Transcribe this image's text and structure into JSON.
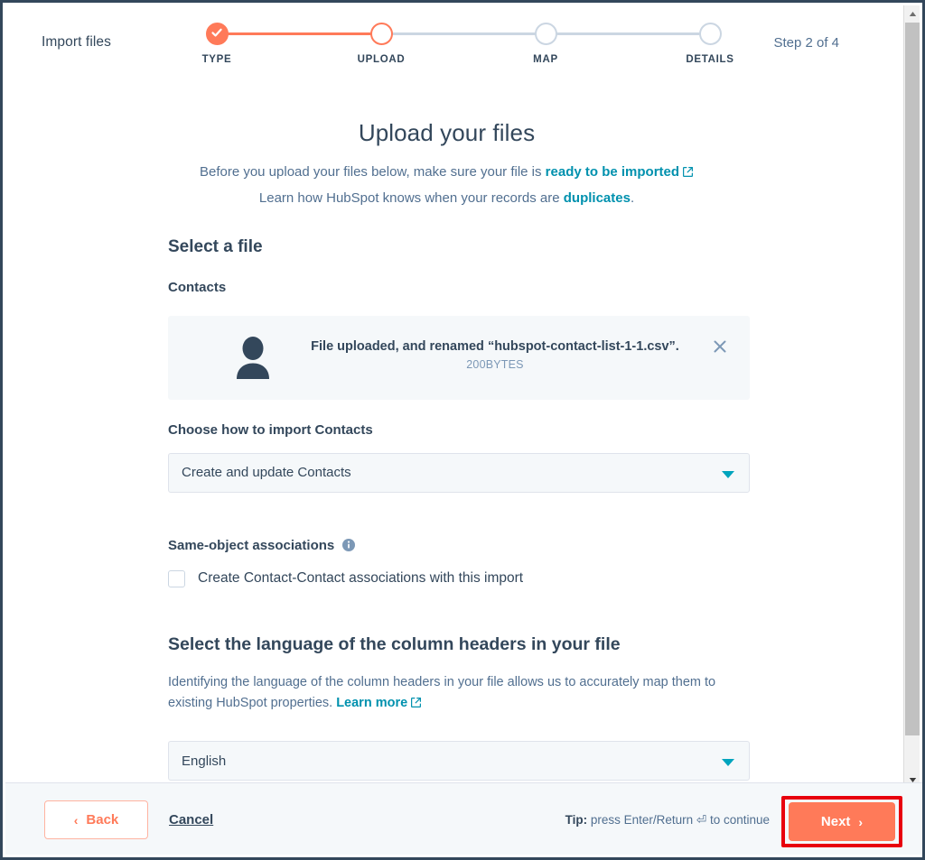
{
  "header": {
    "title": "Import files",
    "step_counter": "Step 2 of 4"
  },
  "stepper": {
    "steps": [
      {
        "label": "TYPE",
        "state": "done"
      },
      {
        "label": "UPLOAD",
        "state": "current"
      },
      {
        "label": "MAP",
        "state": "todo"
      },
      {
        "label": "DETAILS",
        "state": "todo"
      }
    ],
    "done_color": "#ff7a59",
    "todo_color": "#cbd6e2"
  },
  "main": {
    "page_title": "Upload your files",
    "sub_line_1_before": "Before you upload your files below, make sure your file is ",
    "sub_line_1_link": "ready to be imported",
    "sub_line_2_before": "Learn how HubSpot knows when your records are ",
    "sub_line_2_link": "duplicates",
    "sub_line_2_after": ".",
    "select_a_file_heading": "Select a file",
    "contacts_label": "Contacts",
    "file_card": {
      "icon": "contact-avatar-icon",
      "message": "File uploaded, and renamed “hubspot-contact-list-1-1.csv”.",
      "size": "200BYTES",
      "close_icon": "close-icon"
    },
    "import_mode_label": "Choose how to import Contacts",
    "import_mode_value": "Create and update Contacts",
    "same_object_heading": "Same-object associations",
    "same_object_info_icon": "info-icon",
    "same_object_checkbox_label": "Create Contact-Contact associations with this import",
    "same_object_checkbox_checked": false,
    "language_heading": "Select the language of the column headers in your file",
    "language_desc_before": "Identifying the language of the column headers in your file allows us to accurately map them to existing HubSpot properties. ",
    "language_desc_link": "Learn more",
    "language_value": "English",
    "link_color": "#0091ae",
    "caret_color": "#00a4bd"
  },
  "footer": {
    "back_label": "Back",
    "back_chevron": "‹",
    "cancel_label": "Cancel",
    "tip_bold": "Tip:",
    "tip_text": " press Enter/Return ⏎ to continue",
    "next_label": "Next",
    "next_chevron": "›",
    "next_color": "#ff7a59",
    "highlight_color": "#e8000d"
  },
  "scrollbar": {
    "up_arrow_icon": "scroll-up-arrow-icon",
    "down_arrow_icon": "scroll-down-arrow-icon",
    "thumb": "scrollbar-thumb"
  }
}
